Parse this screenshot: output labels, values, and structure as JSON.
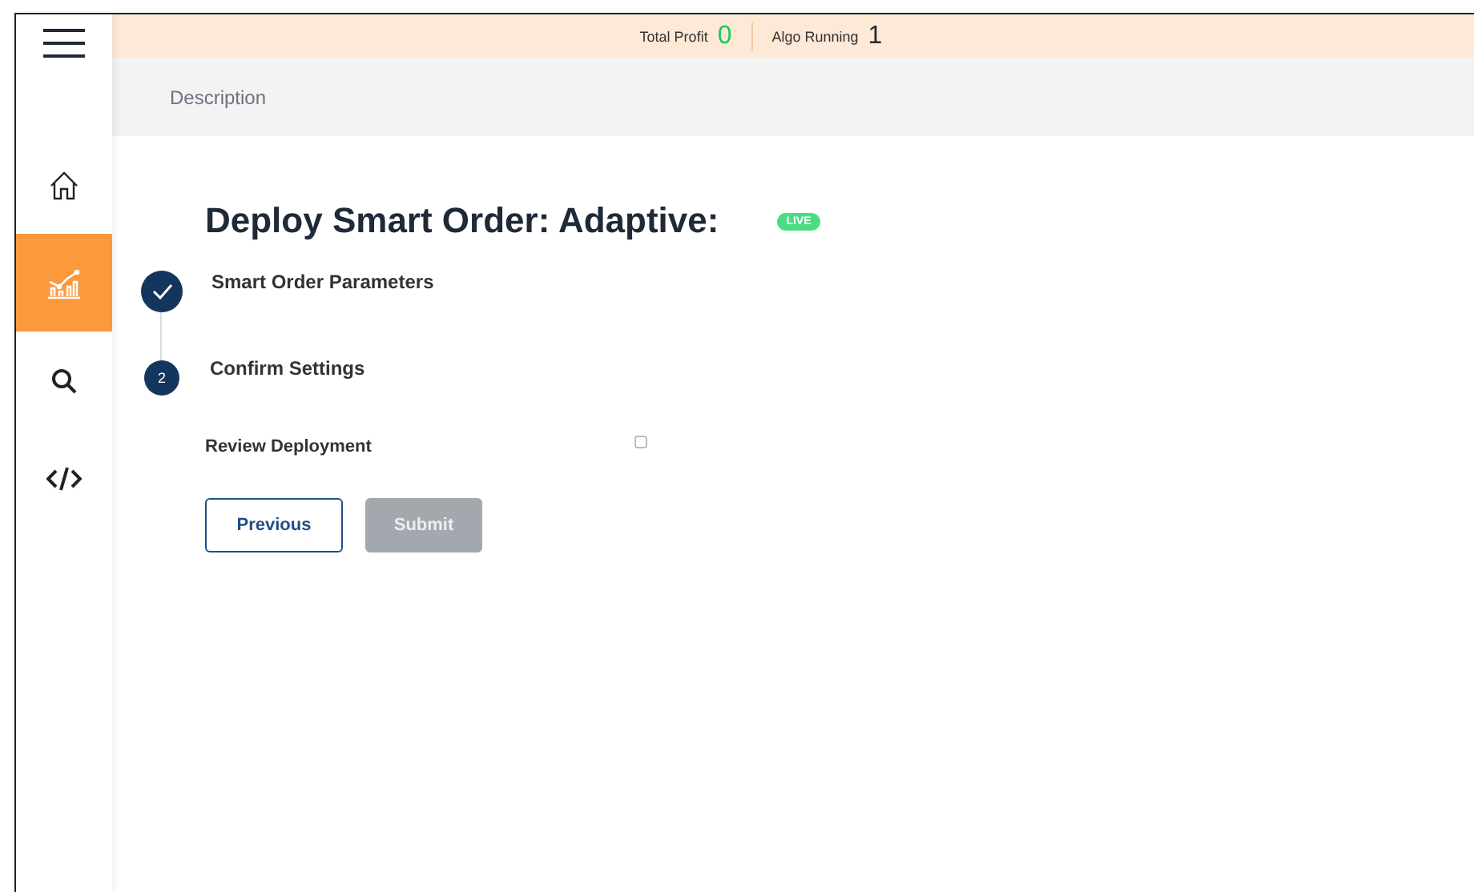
{
  "sidebar": {
    "items": [
      {
        "kind": "home",
        "selected": false
      },
      {
        "kind": "chart",
        "selected": true
      },
      {
        "kind": "search",
        "selected": false
      },
      {
        "kind": "code",
        "selected": false
      }
    ]
  },
  "stats": [
    {
      "label": "Total Profit",
      "value": "0",
      "kind": "profit"
    },
    {
      "label": "Algo Running",
      "value": "1",
      "kind": "count"
    }
  ],
  "breadcrumb": "Description",
  "title": "Deploy Smart Order: Adaptive:",
  "badge": "LIVE",
  "steps": [
    {
      "label": "Smart Order Parameters",
      "completed": true
    },
    {
      "label": "Confirm Settings",
      "number": "2",
      "completed": false
    }
  ],
  "review": {
    "label": "Review Deployment",
    "checked": false
  },
  "buttons": [
    {
      "label": "Previous",
      "disabled": false
    },
    {
      "label": "Submit",
      "disabled": true
    }
  ]
}
